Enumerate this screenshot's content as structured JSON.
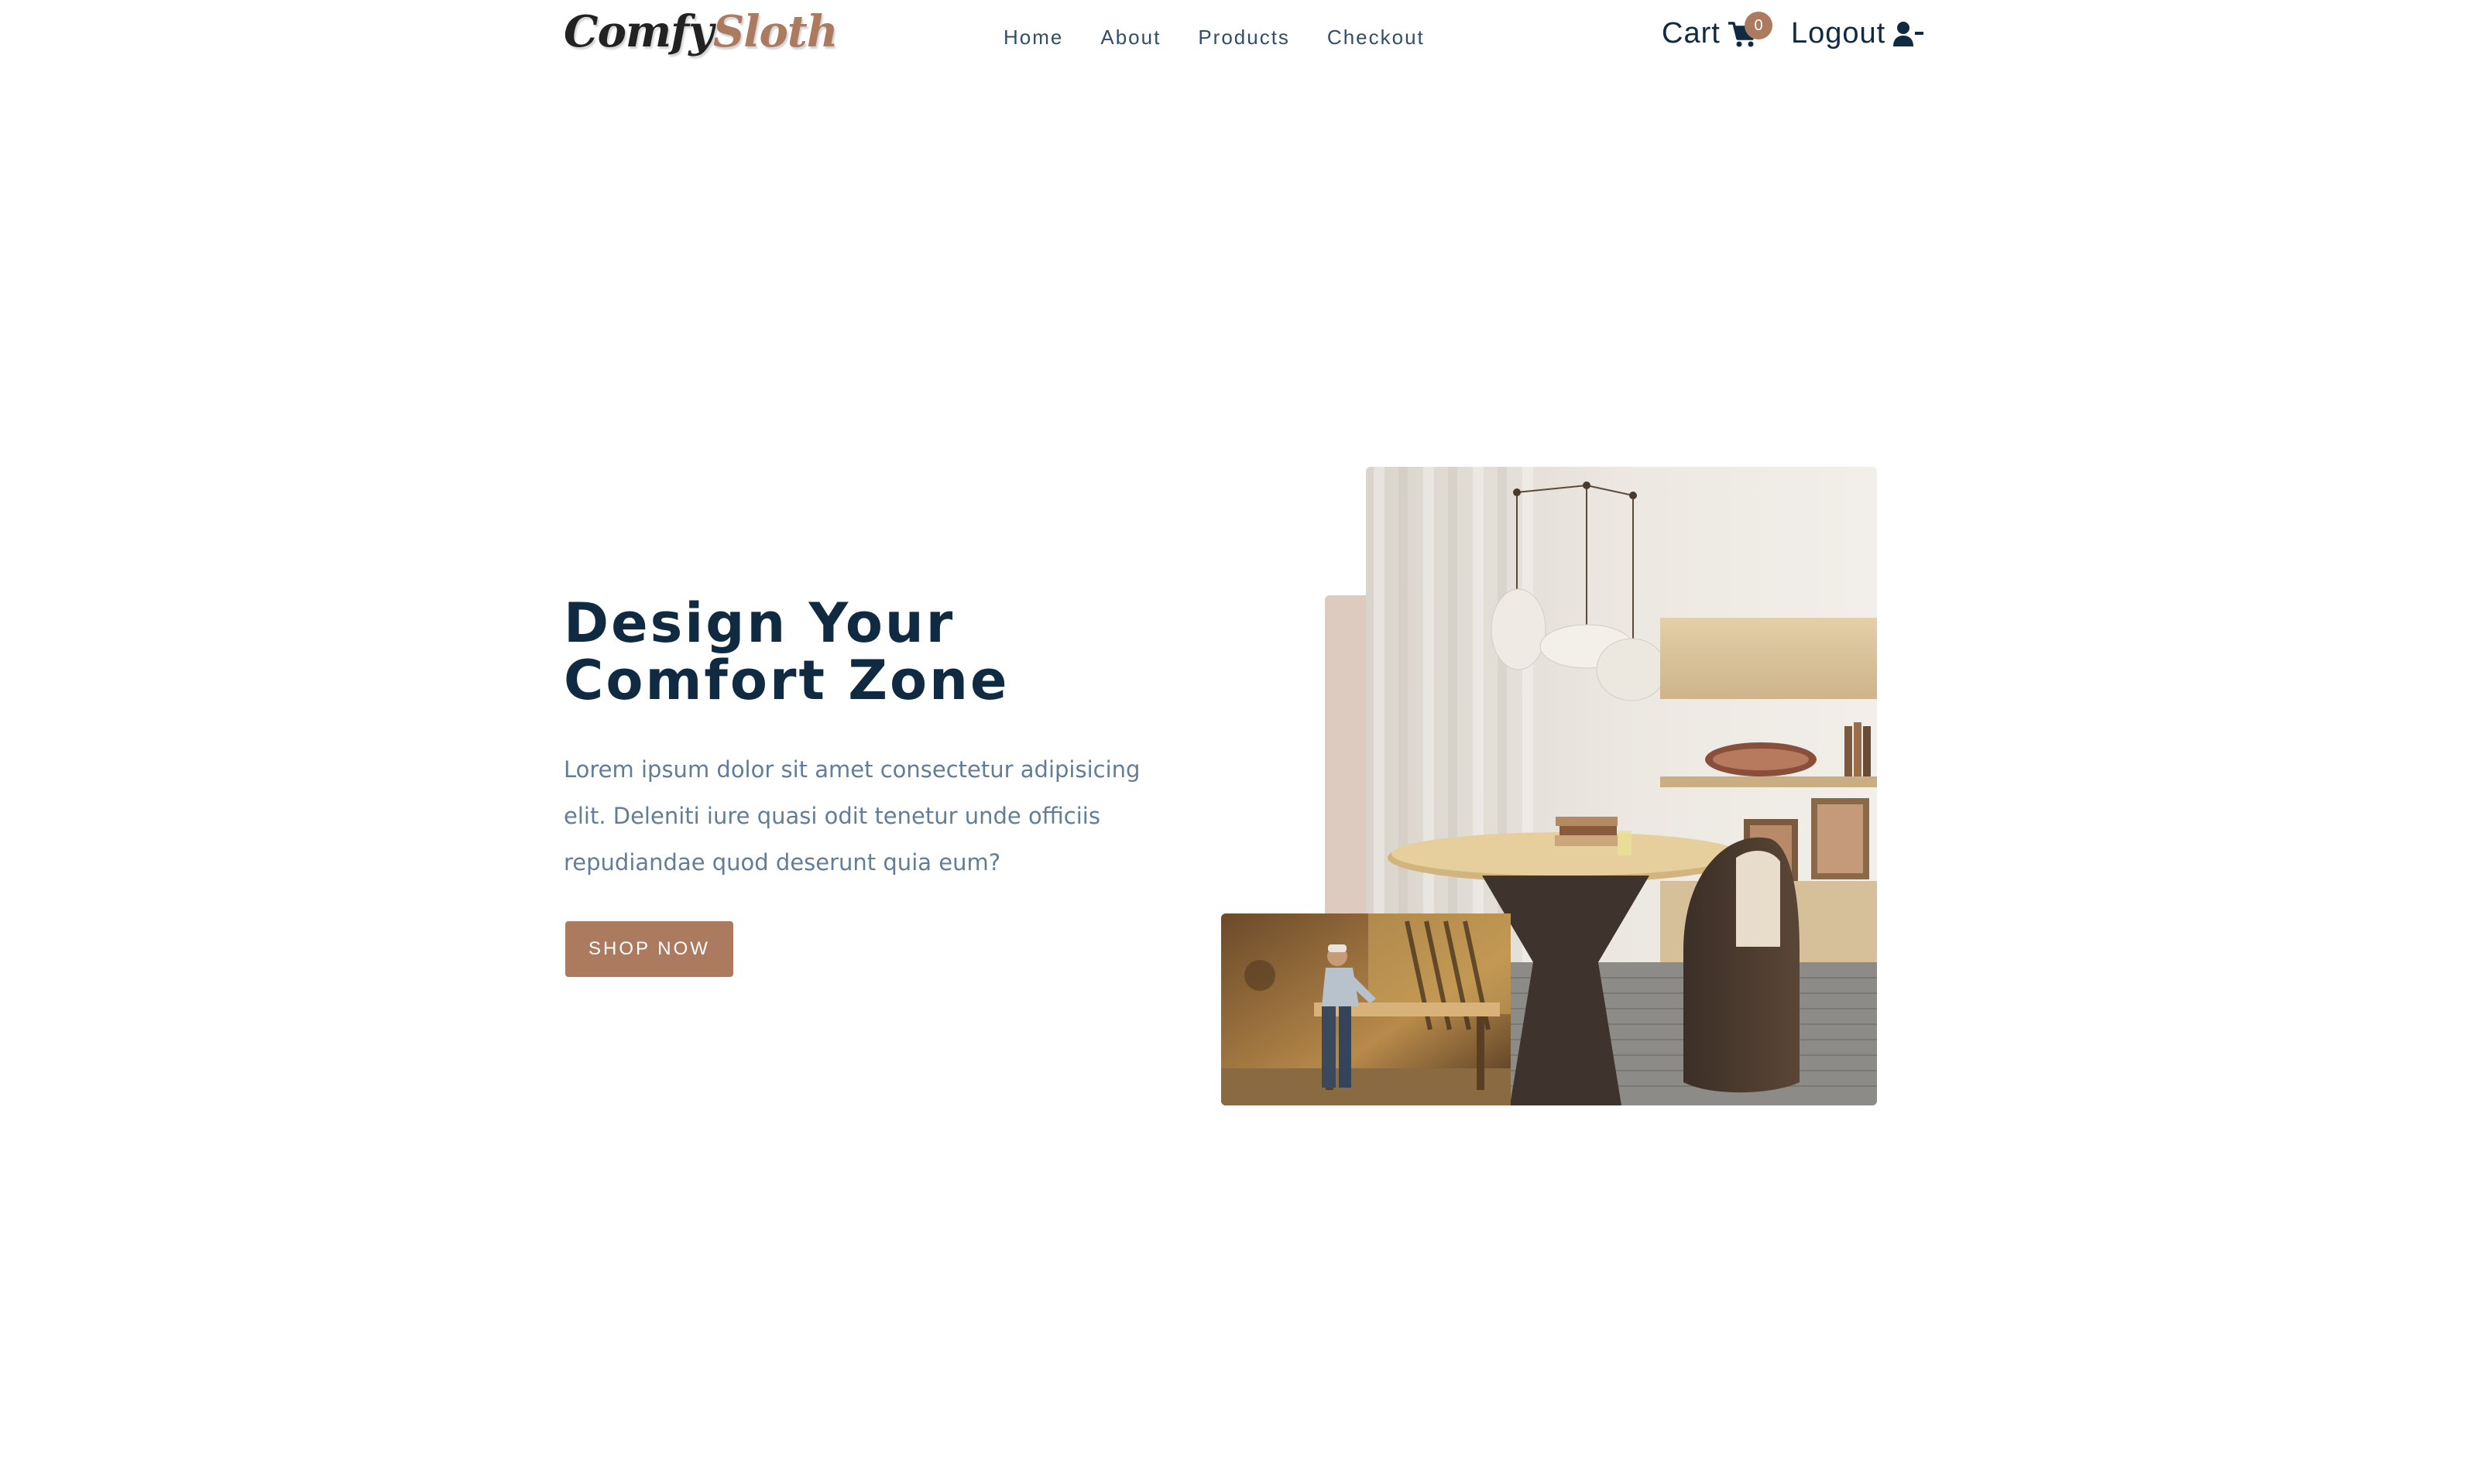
{
  "brand": {
    "part1": "Comfy",
    "part2": "Sloth"
  },
  "nav": {
    "links": [
      {
        "label": "Home"
      },
      {
        "label": "About"
      },
      {
        "label": "Products"
      },
      {
        "label": "Checkout"
      }
    ]
  },
  "cart": {
    "label": "Cart",
    "count": "0",
    "icon": "cart-icon"
  },
  "auth": {
    "label": "Logout",
    "icon": "user-minus-icon"
  },
  "hero": {
    "title_line1": "Design Your",
    "title_line2": "Comfort Zone",
    "text": "Lorem ipsum dolor sit amet consectetur adipisicing elit. Deleniti iure quasi odit tenetur unde officiis repudiandae quod deserunt quia eum?",
    "button_label": "SHOP NOW"
  },
  "colors": {
    "primary": "#ab7a5f",
    "heading": "#102a42",
    "body_text": "#617d98",
    "accent_block": "#decbc0"
  }
}
